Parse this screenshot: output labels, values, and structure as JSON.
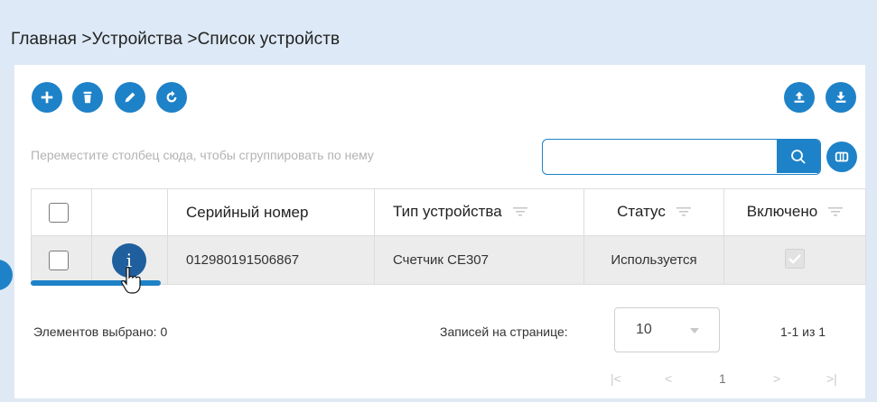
{
  "breadcrumb": {
    "home": "Главная",
    "sep1": " >",
    "devices": "Устройства",
    "sep2": " >",
    "list": "Список устройств"
  },
  "toolbar": {
    "add_icon": "plus-icon",
    "delete_icon": "trash-icon",
    "edit_icon": "pencil-icon",
    "refresh_icon": "refresh-icon",
    "upload_icon": "upload-icon",
    "download_icon": "download-icon"
  },
  "group_hint": "Переместите столбец сюда, чтобы сгруппировать по нему",
  "search": {
    "value": "",
    "placeholder": ""
  },
  "table": {
    "columns": [
      "Серийный номер",
      "Тип устройства",
      "Статус",
      "Включено"
    ],
    "rows": [
      {
        "serial": "012980191506867",
        "type": "Счетчик CE307",
        "status": "Используется",
        "enabled": true,
        "info": "i"
      }
    ]
  },
  "footer": {
    "selected": "Элементов выбрано: 0",
    "per_page_label": "Записей на странице:",
    "per_page_value": "10",
    "range": "1-1 из 1",
    "current_page": "1",
    "nav_first": "|<",
    "nav_prev": "<",
    "nav_next": ">",
    "nav_last": ">|"
  },
  "colors": {
    "accent": "#1e82c8",
    "info": "#1f5f9e",
    "header_bg": "#dde9f6",
    "row_bg": "#ececec"
  }
}
